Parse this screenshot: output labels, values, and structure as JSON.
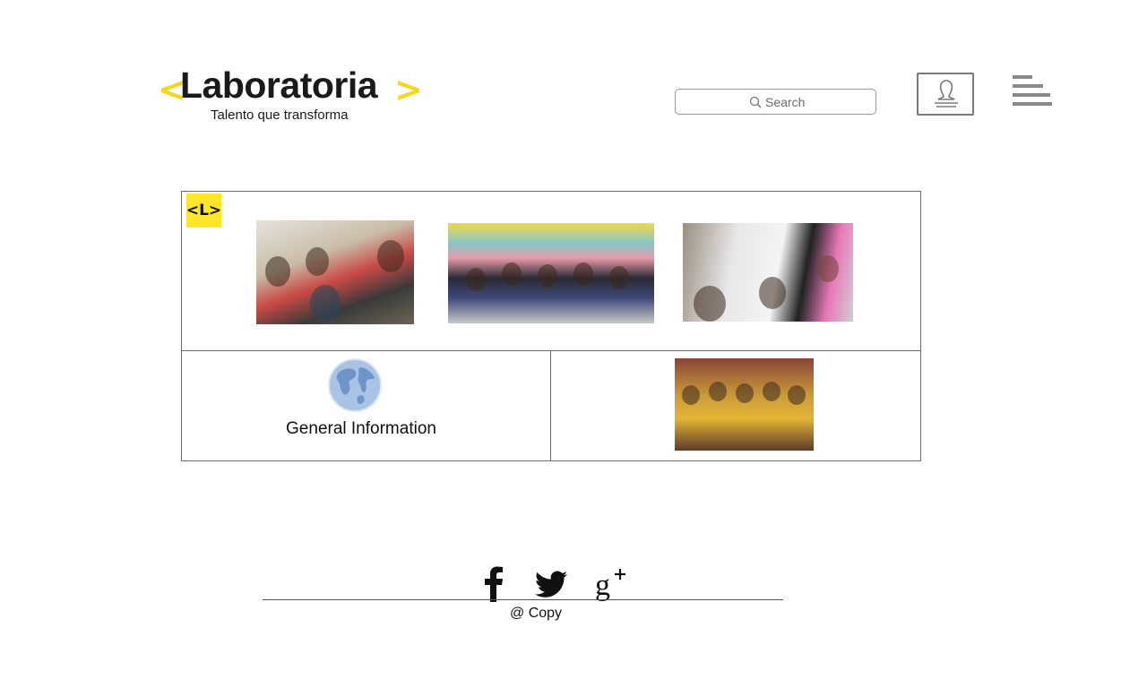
{
  "header": {
    "logo": {
      "open_bracket": "<",
      "wordmark": "Laboratoria",
      "close_bracket": ">",
      "tagline": "Talento que transforma",
      "accent_color": "#f5d81e"
    },
    "search": {
      "placeholder": "Search",
      "icon": "search-icon"
    },
    "user_button": {
      "icon": "user-icon"
    },
    "menu_button": {
      "icon": "hamburger-menu-icon"
    }
  },
  "main": {
    "badge": {
      "text": "<L>",
      "color": "#ffe629"
    },
    "photos": [
      {
        "name": "students-group-photo"
      },
      {
        "name": "class-group-photo"
      },
      {
        "name": "classroom-photo"
      }
    ],
    "general_info": {
      "icon": "globe-icon",
      "label": "General Information"
    },
    "graduation_photo": {
      "name": "graduation-group-photo"
    }
  },
  "footer": {
    "social": [
      {
        "name": "facebook-icon"
      },
      {
        "name": "twitter-icon"
      },
      {
        "name": "google-plus-icon"
      }
    ],
    "copyright": "@ Copy"
  }
}
